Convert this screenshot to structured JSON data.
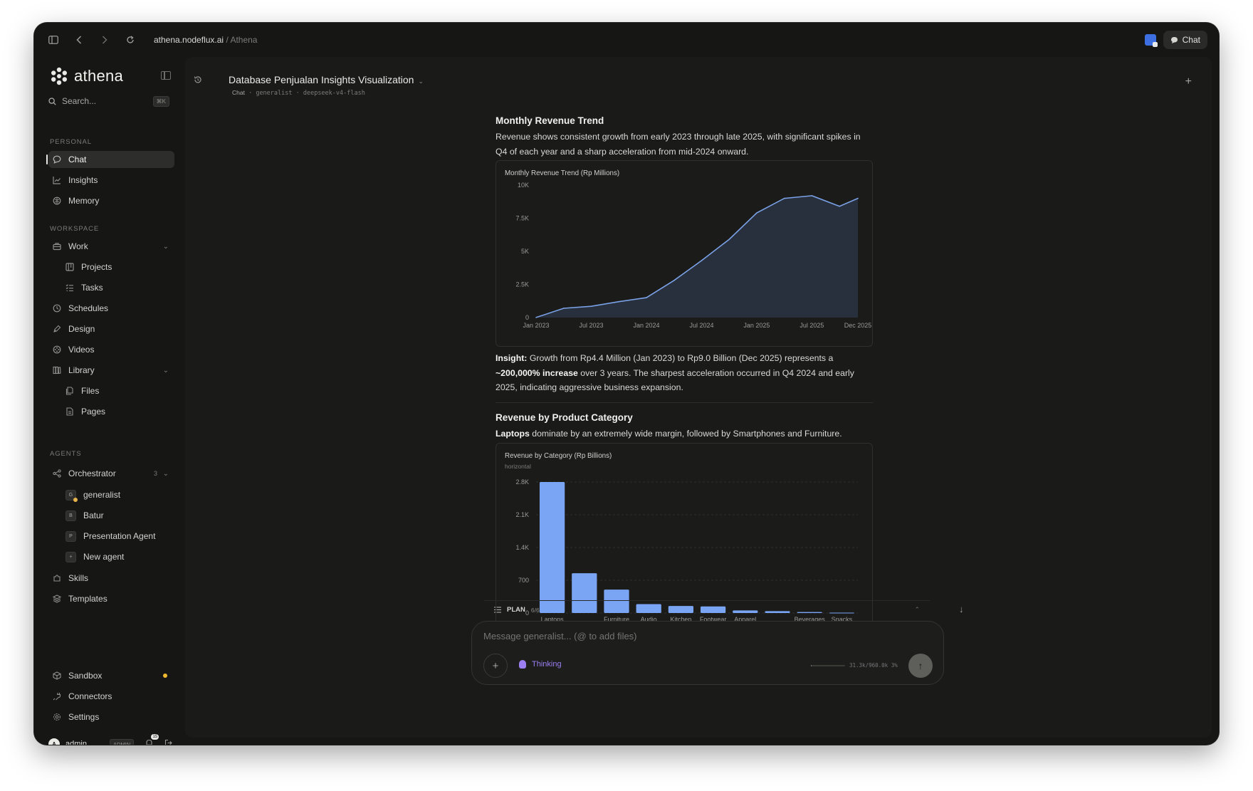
{
  "browser": {
    "url_host": "athena.nodeflux.ai",
    "url_path": "/ Athena",
    "chat_button": "Chat"
  },
  "sidebar": {
    "brand": "athena",
    "search_placeholder": "Search...",
    "search_kbd": "⌘K",
    "sections": {
      "personal": "PERSONAL",
      "workspace": "WORKSPACE",
      "agents": "AGENTS"
    },
    "personal": [
      {
        "label": "Chat",
        "icon": "chat-bubble-icon",
        "active": true
      },
      {
        "label": "Insights",
        "icon": "trend-icon"
      },
      {
        "label": "Memory",
        "icon": "brain-icon"
      }
    ],
    "workspace": {
      "work": "Work",
      "projects": "Projects",
      "tasks": "Tasks",
      "schedules": "Schedules",
      "design": "Design",
      "videos": "Videos",
      "library": "Library",
      "files": "Files",
      "pages": "Pages"
    },
    "agents": {
      "orchestrator": "Orchestrator",
      "orchestrator_count": "3",
      "items": [
        {
          "badge": "G",
          "label": "generalist"
        },
        {
          "badge": "B",
          "label": "Batur"
        },
        {
          "badge": "P",
          "label": "Presentation Agent"
        },
        {
          "badge": "+",
          "label": "New agent"
        }
      ]
    },
    "skills": "Skills",
    "templates": "Templates",
    "bottom": {
      "sandbox": "Sandbox",
      "connectors": "Connectors",
      "settings": "Settings"
    },
    "user": {
      "initial": "A",
      "name": "admin",
      "role": "ADMIN",
      "notifications": "15"
    }
  },
  "conversation": {
    "title": "Database Penjualan Insights Visualization",
    "meta_first": "Chat",
    "meta_rest": " · generalist · deepseek-v4-flash"
  },
  "message": {
    "section1": {
      "heading": "Monthly Revenue Trend",
      "text": "Revenue shows consistent growth from early 2023 through late 2025, with significant spikes in Q4 of each year and a sharp acceleration from mid-2024 onward."
    },
    "insight": {
      "label": "Insight:",
      "text1": " Growth from Rp4.4 Million (Jan 2023) to Rp9.0 Billion (Dec 2025) represents a ",
      "bold": "~200,000% increase",
      "text2": " over 3 years. The sharpest acceleration occurred in Q4 2024 and early 2025, indicating aggressive business expansion."
    },
    "section2": {
      "heading": "Revenue by Product Category",
      "lead_bold": "Laptops",
      "text": " dominate by an extremely wide margin, followed by Smartphones and Furniture."
    }
  },
  "chart_data": [
    {
      "type": "area",
      "title": "Monthly Revenue Trend (Rp Millions)",
      "xlabel": "",
      "ylabel": "",
      "ylim": [
        0,
        10000
      ],
      "y_ticks": [
        "0",
        "2.5K",
        "5K",
        "7.5K",
        "10K"
      ],
      "y_tick_values": [
        0,
        2500,
        5000,
        7500,
        10000
      ],
      "x_ticks": [
        "Jan 2023",
        "Jul 2023",
        "Jan 2024",
        "Jul 2024",
        "Jan 2025",
        "Jul 2025",
        "Dec 2025"
      ],
      "x_tick_months": [
        0,
        6,
        12,
        18,
        24,
        30,
        35
      ],
      "series": [
        {
          "x_months": [
            0,
            3,
            6,
            9,
            12,
            15,
            18,
            21,
            24,
            27,
            30,
            33,
            35
          ],
          "values": [
            4.4,
            700,
            850,
            1200,
            1500,
            2800,
            4300,
            5900,
            7900,
            9000,
            9200,
            8400,
            9000
          ]
        }
      ],
      "grid": false,
      "color": "#7aa1e6",
      "fill": "#29303d"
    },
    {
      "type": "bar",
      "title": "Revenue by Category (Rp Billions)",
      "subtitle": "horizontal",
      "ylim": [
        0,
        2800
      ],
      "y_ticks": [
        "0",
        "700",
        "1.4K",
        "2.1K",
        "2.8K"
      ],
      "y_tick_values": [
        0,
        700,
        1400,
        2100,
        2800
      ],
      "categories": [
        "Laptops",
        "",
        "Furniture",
        "Audio",
        "Kitchen",
        "Footwear",
        "Apparel",
        "",
        "Beverages",
        "Snacks"
      ],
      "values": [
        2800,
        850,
        500,
        190,
        150,
        140,
        55,
        40,
        20,
        8
      ],
      "grid": true,
      "color": "#7aa5f5"
    }
  ],
  "plan": {
    "label": "PLAN",
    "count": "6/6"
  },
  "composer": {
    "placeholder": "Message generalist... (@ to add files)",
    "thinking": "Thinking",
    "usage": "31.3k/960.0k 3%",
    "usage_fraction": 0.03
  }
}
